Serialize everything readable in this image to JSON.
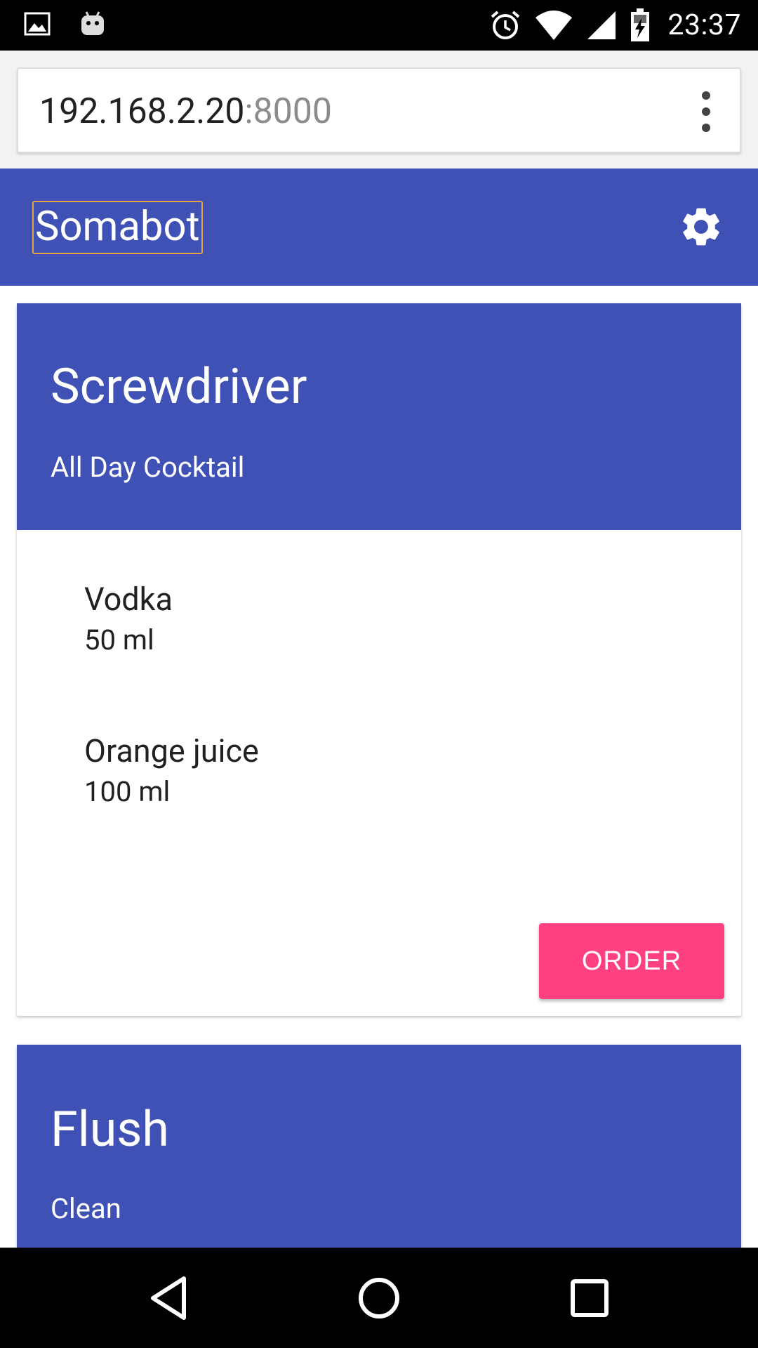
{
  "status_bar": {
    "time": "23:37",
    "icons": [
      "image-icon",
      "android-icon",
      "alarm-icon",
      "wifi-icon",
      "signal-icon",
      "battery-charging-icon"
    ]
  },
  "browser": {
    "url_host": "192.168.2.20",
    "url_port": ":8000",
    "menu_icon": "more-vert-icon"
  },
  "app": {
    "title": "Somabot",
    "settings_icon": "gear-icon",
    "primary_color": "#3f51b5",
    "accent_color": "#ff4081"
  },
  "cards": [
    {
      "title": "Screwdriver",
      "subtitle": "All Day Cocktail",
      "ingredients": [
        {
          "name": "Vodka",
          "amount": "50 ml"
        },
        {
          "name": "Orange juice",
          "amount": "100 ml"
        }
      ],
      "order_label": "ORDER"
    },
    {
      "title": "Flush",
      "subtitle": "Clean"
    }
  ],
  "nav_bar": {
    "icons": [
      "back-icon",
      "home-icon",
      "recents-icon"
    ]
  }
}
